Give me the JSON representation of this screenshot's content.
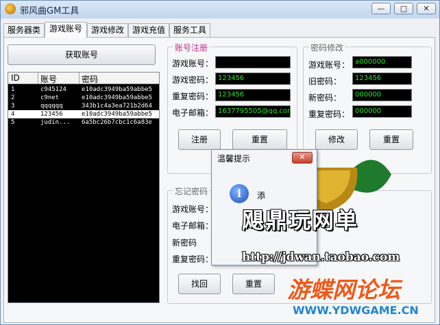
{
  "window": {
    "title": "邪风曲GM工具",
    "min_label": "—",
    "max_label": "□",
    "close_label": "✕"
  },
  "tabs": [
    {
      "label": "服务器类"
    },
    {
      "label": "游戏账号"
    },
    {
      "label": "游戏修改"
    },
    {
      "label": "游戏充值"
    },
    {
      "label": "服务工具"
    }
  ],
  "left": {
    "fetch_button": "获取账号",
    "columns": [
      "ID",
      "账号",
      "密码"
    ],
    "rows": [
      {
        "id": "1",
        "account": "c945124",
        "password": "e10adc3949ba59abbe5"
      },
      {
        "id": "2",
        "account": "c9net",
        "password": "e10adc3949ba59abbe5"
      },
      {
        "id": "3",
        "account": "qqqqqq",
        "password": "343b1c4a3ea721b2d64"
      },
      {
        "id": "4",
        "account": "123456",
        "password": "e10adc3949ba59abbe5",
        "selected": true
      },
      {
        "id": "5",
        "account": "judin...",
        "password": "6a5bc26b7cbc1c6a83e"
      }
    ]
  },
  "register": {
    "title": "账号注册",
    "account_label": "游戏账号：",
    "account_value": "",
    "password_label": "游戏密码：",
    "password_value": "123456",
    "repeat_label": "重复密码：",
    "repeat_value": "123456",
    "email_label": "电子邮箱：",
    "email_value": "1637795505@qq.com",
    "submit": "注册",
    "reset": "重置"
  },
  "change_pw": {
    "title": "密码修改",
    "account_label": "游戏账号：",
    "account_value": "a000000",
    "old_label": "旧密码：",
    "old_value": "123456",
    "new_label": "新密码：",
    "new_value": "000000",
    "repeat_label": "重复密码：",
    "repeat_value": "000000",
    "submit": "修改",
    "reset": "重置"
  },
  "forgot": {
    "title": "忘记密码",
    "account_label": "游戏账号：",
    "email_label": "电子邮箱：",
    "new_label": "新密码",
    "repeat_label": "重复密码：",
    "submit": "找回",
    "reset": "重置"
  },
  "dialog": {
    "title": "温馨提示",
    "close": "✕",
    "message": "添"
  },
  "watermark": {
    "line1": "飓鼎玩网单",
    "line2": "http://jdwan.taobao.com",
    "line3": "游蝶网论坛",
    "line4": "WWW.YDWGAME.CN"
  }
}
